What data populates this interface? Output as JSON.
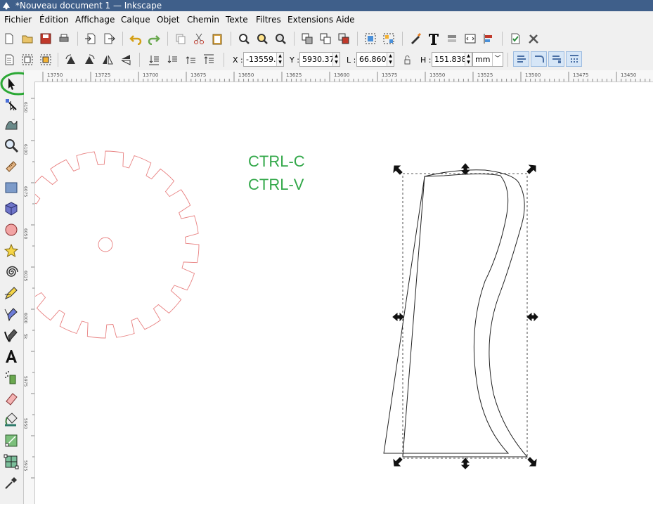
{
  "window": {
    "title": "*Nouveau document 1 — Inkscape"
  },
  "menu": [
    {
      "label": "Fichier"
    },
    {
      "label": "Édition"
    },
    {
      "label": "Affichage"
    },
    {
      "label": "Calque"
    },
    {
      "label": "Objet"
    },
    {
      "label": "Chemin"
    },
    {
      "label": "Texte"
    },
    {
      "label": "Filtres"
    },
    {
      "label": "Extensions"
    },
    {
      "label": "Aide"
    }
  ],
  "controls": {
    "x_label": "X :",
    "x_value": "-13559.",
    "y_label": "Y :",
    "y_value": "5930.37",
    "w_label": "L :",
    "w_value": "66.860",
    "h_label": "H :",
    "h_value": "151.838",
    "unit": "mm"
  },
  "ruler": {
    "top_ticks": [
      "13750",
      "13725",
      "13700",
      "13675",
      "13650",
      "13625",
      "13600",
      "13575",
      "13550",
      "13525",
      "13500",
      "13475",
      "13450"
    ],
    "left_ticks": [
      "6150",
      "6100",
      "6075",
      "6050",
      "6025",
      "6000",
      "5k",
      "5975",
      "5950",
      "5925"
    ]
  },
  "canvas": {
    "annotation_lines": [
      "CTRL-C",
      "CTRL-V"
    ]
  },
  "colors": {
    "titlebar": "#3f5f8a",
    "gear_stroke": "#e88080",
    "annotation_text": "#33a84a",
    "highlight_ring": "#2aa834",
    "snap_active": "#d6e6f7"
  },
  "icons": {
    "selector_tool": "arrow-pointer-icon",
    "node_tool": "node-icon",
    "tweak_tool": "tweak-icon",
    "zoom_tool": "magnifier-icon",
    "measure_tool": "ruler-icon",
    "rect_tool": "rectangle-icon",
    "box3d_tool": "cube-icon",
    "ellipse_tool": "circle-icon",
    "star_tool": "star-icon",
    "spiral_tool": "spiral-icon",
    "pencil_tool": "pencil-icon",
    "pen_tool": "pen-icon",
    "calligraphy_tool": "calligraphy-icon",
    "text_tool": "text-a-icon",
    "spray_tool": "spray-icon",
    "eraser_tool": "eraser-icon",
    "bucket_tool": "paint-bucket-icon",
    "gradient_tool": "gradient-icon",
    "mesh_tool": "mesh-icon",
    "dropper_tool": "dropper-icon"
  }
}
